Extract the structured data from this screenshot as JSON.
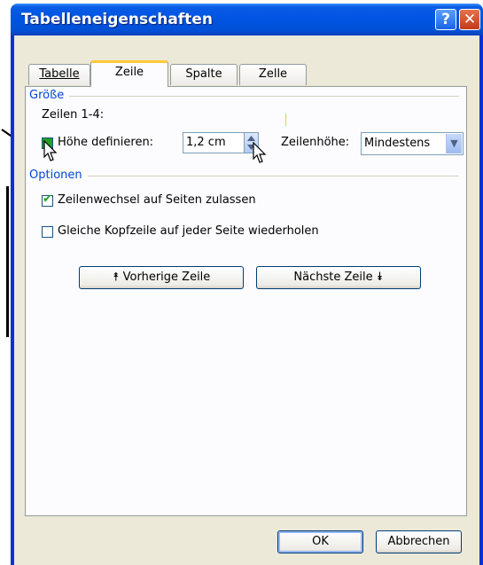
{
  "window": {
    "title": "Tabelleneigenschaften",
    "help_glyph": "?",
    "close_glyph": "✕"
  },
  "tabs": [
    {
      "label": "Tabelle"
    },
    {
      "label": "Zeile"
    },
    {
      "label": "Spalte"
    },
    {
      "label": "Zelle"
    }
  ],
  "size_group": {
    "label": "Größe",
    "rows_label": "Zeilen 1-4:",
    "height_checkbox_label": "Höhe definieren:",
    "height_value": "1,2 cm",
    "row_height_label": "Zeilenhöhe:",
    "row_height_mode": "Mindestens"
  },
  "options_group": {
    "label": "Optionen",
    "allow_break_label": "Zeilenwechsel auf Seiten zulassen",
    "allow_break_checked": true,
    "repeat_header_label": "Gleiche Kopfzeile auf jeder Seite wiederholen",
    "repeat_header_checked": false
  },
  "nav_buttons": {
    "previous_label": "Vorherige Zeile",
    "next_label": "Nächste Zeile"
  },
  "footer": {
    "ok_label": "OK",
    "cancel_label": "Abbrechen"
  },
  "colors": {
    "accent": "#0046d5",
    "title_bar": "#0054e3",
    "panel": "#fcfcfe",
    "check_green": "#21a121"
  }
}
